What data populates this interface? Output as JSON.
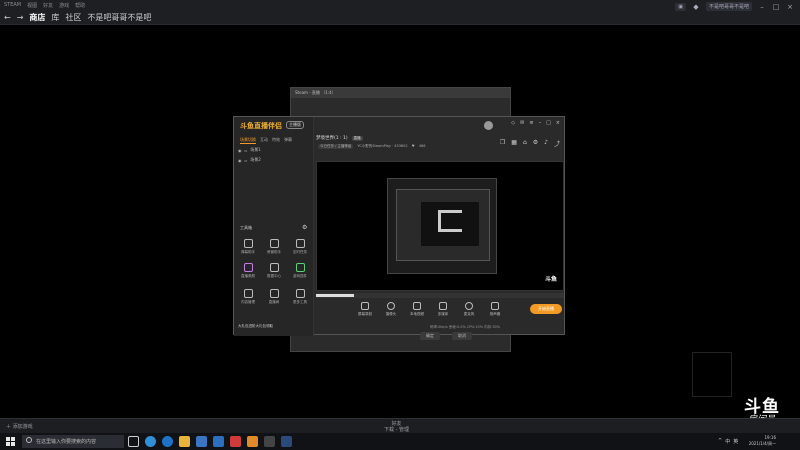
{
  "topbar": {
    "tiny": [
      "STEAM",
      "视图",
      "好友",
      "游戏",
      "帮助"
    ],
    "nav": [
      "商店",
      "库",
      "社区",
      "不是吧哥哥不是吧"
    ],
    "active_index": 0,
    "right_pill": "不是吧哥哥不是吧"
  },
  "backwin": {
    "title": "Steam - 直播 （1:4）"
  },
  "app": {
    "logo": "斗鱼直播伴侣",
    "version": "主播版",
    "sidetabs": [
      "场景切换",
      "互动",
      "特效",
      "弹幕"
    ],
    "scenes": [
      "场景1",
      "场景2"
    ],
    "tools_title": "工具箱",
    "tools": [
      "弹幕助手",
      "房管助手",
      "定时任务",
      "直播美颜",
      "数据中心",
      "游戏插件",
      "内容管理",
      "直播间",
      "更多工具"
    ],
    "gift": "大礼包进阶大礼包领取",
    "header_title": "梦境世界(1 : 1)",
    "header_tag": "直播",
    "sub_chip": "今日任务 / 主播等级",
    "sub_text": "YC小野的SteamPlay · 453602",
    "sub_count": "466",
    "watermark": "斗鱼",
    "bottom_tools": [
      "屏幕录制",
      "摄像头",
      "本地视频",
      "多媒体",
      "麦克风",
      "扬声器"
    ],
    "go_live": "开始直播",
    "bottom_stat": "码率:0kb/s 丢帧:0.0% CPU:15% 内存:30%"
  },
  "dialog": {
    "left_btn": "确定",
    "right_btn": "取消"
  },
  "steam_bottom": {
    "left": "添加游戏",
    "center_top": "好友",
    "center_bottom": "下载 - 管理"
  },
  "douyu": {
    "logo": "斗鱼",
    "label": "房间号",
    "room": "453602"
  },
  "taskbar": {
    "search_placeholder": "在这里输入你要搜索的内容",
    "time": "19:16",
    "date": "2021/1/4/周一",
    "tray_icons": [
      "^",
      "中",
      "英"
    ]
  },
  "colors": {
    "accent": "#f39a25",
    "bg": "#000000"
  }
}
